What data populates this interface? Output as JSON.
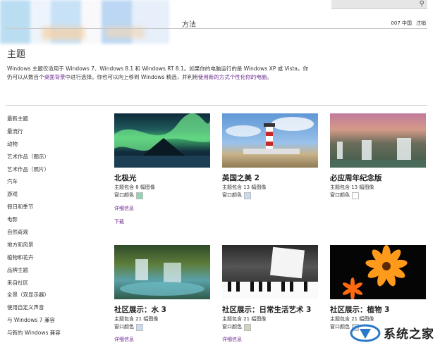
{
  "header": {
    "nav_tail": "方法",
    "search_placeholder": "",
    "links": [
      "007 中国",
      "注销"
    ]
  },
  "page": {
    "title": "主题",
    "intro_line1": "Windows 主题仅适用于 Windows 7、Windows 8.1 和 Windows RT 8.1。如果你的电脑运行的是 Windows XP 或 Vista，你",
    "intro_line2_a": "仍可以从数百个",
    "intro_line2_link1": "桌面背景",
    "intro_line2_b": "中进行选择。你也可以向上移到 Windows 精选，并利用",
    "intro_line2_link2": "使用新的方式个性化你的电脑",
    "intro_line2_c": "。"
  },
  "sidebar": {
    "items": [
      "最新主题",
      "最流行",
      "动物",
      "艺术作品（图示）",
      "艺术作品（照片）",
      "汽车",
      "游戏",
      "假日和季节",
      "电影",
      "自然奇观",
      "地方和风景",
      "植物和花卉",
      "品牌主题",
      "来自社区",
      "全景（双显示器）",
      "使用自定义声音",
      "与 Windows 7 兼容",
      "与新的 Windows 兼容"
    ]
  },
  "cards": [
    {
      "title": "北极光",
      "meta": "主题包含 8 幅图像",
      "color_label": "窗口颜色",
      "swatch": "#8fd6b0",
      "link1": "详细信息",
      "link2": "下载"
    },
    {
      "title": "英国之美 2",
      "meta": "主题包含 13 幅图像",
      "color_label": "窗口颜色",
      "swatch": "#c8dcf0"
    },
    {
      "title": "必应周年纪念版",
      "meta": "主题包含 13 幅图像",
      "color_label": "窗口颜色",
      "swatch": "#ffffff"
    },
    {
      "title": "社区展示：水 3",
      "meta": "主题包含 21 幅图像",
      "color_label": "窗口颜色",
      "swatch": "#c8dcf0",
      "link1": "详细信息"
    },
    {
      "title": "社区展示：日常生活艺术 3",
      "meta": "主题包含 21 幅图像",
      "color_label": "窗口颜色",
      "swatch": "#d6d0c0",
      "link1": "详细信息"
    },
    {
      "title": "社区展示：植物 3",
      "meta": "主题包含 21 幅图像",
      "color_label": "窗口颜色",
      "swatch": "#c8dcf0"
    }
  ],
  "watermark": {
    "text": "系统之家"
  },
  "colors": {
    "link": "#6b2a8f",
    "divider": "#c8c8c8"
  }
}
